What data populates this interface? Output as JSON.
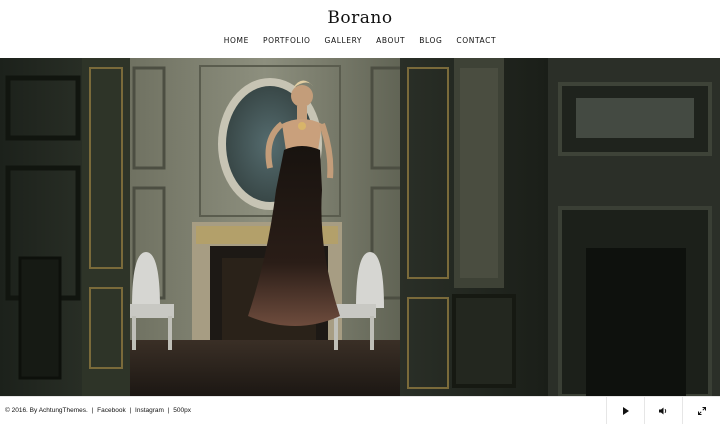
{
  "site": {
    "logo": "Borano"
  },
  "nav": {
    "items": [
      {
        "label": "HOME"
      },
      {
        "label": "PORTFOLIO"
      },
      {
        "label": "GALLERY"
      },
      {
        "label": "ABOUT"
      },
      {
        "label": "BLOG"
      },
      {
        "label": "CONTACT"
      }
    ]
  },
  "footer": {
    "copyright": "© 2016. By AchtungThemes.",
    "links": [
      {
        "label": "Facebook"
      },
      {
        "label": "Instagram"
      },
      {
        "label": "500px"
      }
    ],
    "separator": "|"
  },
  "controls": {
    "play_icon": "play-icon",
    "volume_icon": "volume-icon",
    "fullscreen_icon": "fullscreen-icon"
  },
  "colors": {
    "text": "#111111",
    "background": "#ffffff",
    "divider": "#e6e6e6"
  }
}
